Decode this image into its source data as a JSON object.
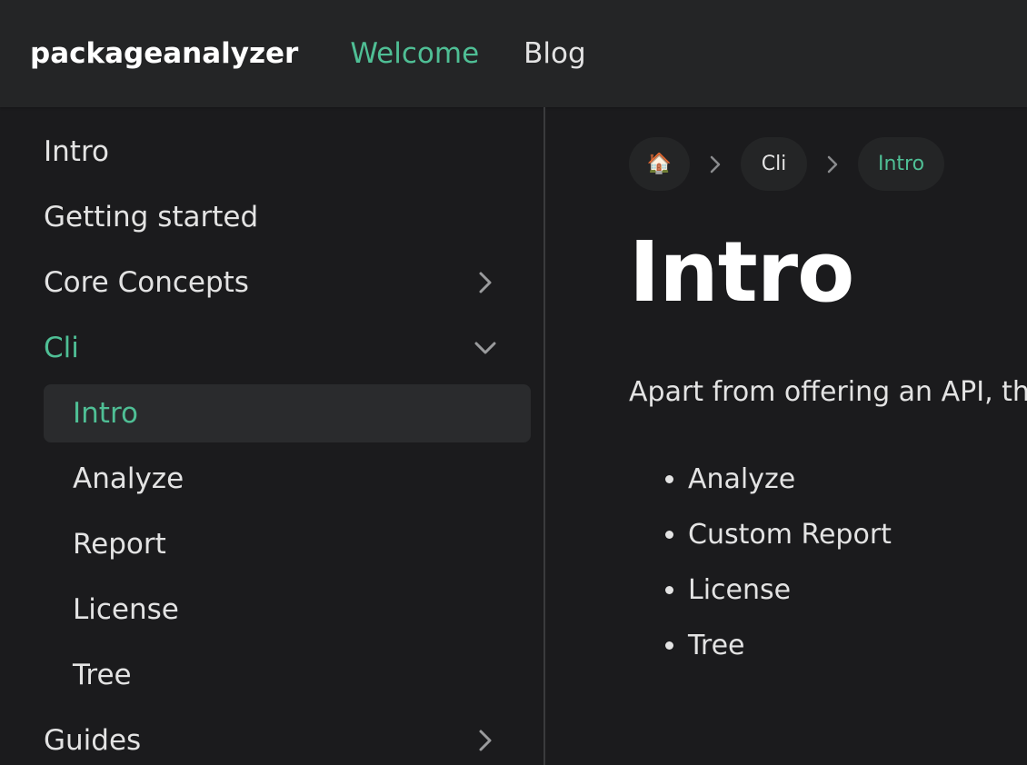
{
  "navbar": {
    "brand": "packageanalyzer",
    "links": [
      {
        "label": "Welcome",
        "active": true
      },
      {
        "label": "Blog",
        "active": false
      }
    ]
  },
  "sidebar": {
    "items": [
      {
        "label": "Intro"
      },
      {
        "label": "Getting started"
      },
      {
        "label": "Core Concepts",
        "icon": "chevron-right-icon"
      },
      {
        "label": "Cli",
        "icon": "chevron-down-icon",
        "expanded": true,
        "active": true
      },
      {
        "label": "Intro",
        "sub": true,
        "active": true
      },
      {
        "label": "Analyze",
        "sub": true
      },
      {
        "label": "Report",
        "sub": true
      },
      {
        "label": "License",
        "sub": true
      },
      {
        "label": "Tree",
        "sub": true
      },
      {
        "label": "Guides",
        "icon": "chevron-right-icon"
      }
    ]
  },
  "breadcrumbs": {
    "home_icon": "🏠",
    "items": [
      "Cli",
      "Intro"
    ],
    "separator_icon": "chevron-right-icon"
  },
  "main": {
    "title": "Intro",
    "paragraph": "Apart from offering an API, the",
    "bullets": [
      "Analyze",
      "Custom Report",
      "License",
      "Tree"
    ]
  },
  "colors": {
    "accent": "#4fbf95",
    "background": "#1b1b1d",
    "navbar": "#242526"
  }
}
